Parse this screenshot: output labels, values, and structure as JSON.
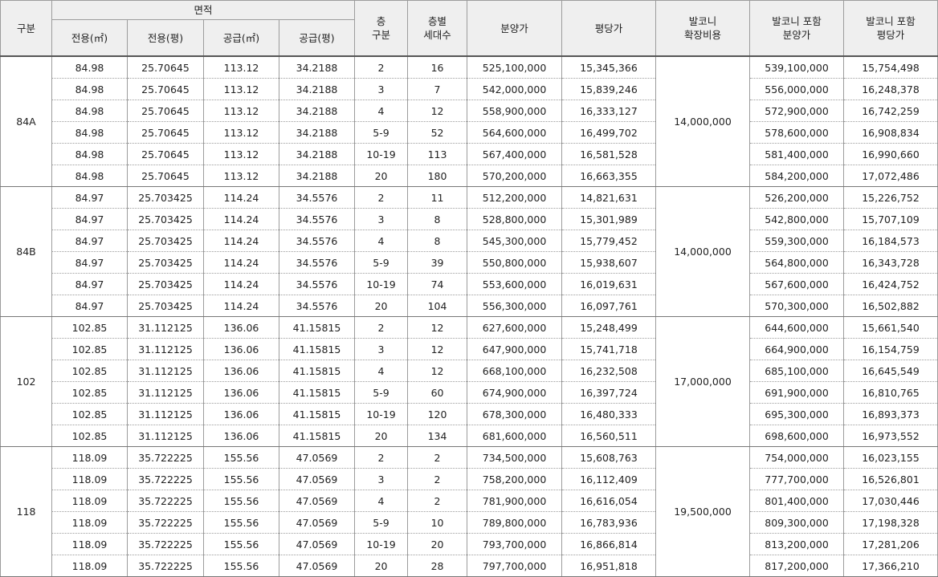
{
  "headers": {
    "type": "구분",
    "area_group": "면적",
    "area_sub": [
      "전용(㎡)",
      "전용(평)",
      "공급(㎡)",
      "공급(평)"
    ],
    "floor": [
      "층",
      "구분"
    ],
    "units": [
      "층별",
      "세대수"
    ],
    "price": "분양가",
    "per_pyeong": "평당가",
    "balcony_cost": [
      "발코니",
      "확장비용"
    ],
    "price_with_balcony": [
      "발코니 포함",
      "분양가"
    ],
    "per_pyeong_with_balcony": [
      "발코니 포함",
      "평당가"
    ]
  },
  "groups": [
    {
      "type": "84A",
      "balcony": "14,000,000",
      "rows": [
        [
          "84.98",
          "25.70645",
          "113.12",
          "34.2188",
          "2",
          "16",
          "525,100,000",
          "15,345,366",
          "539,100,000",
          "15,754,498"
        ],
        [
          "84.98",
          "25.70645",
          "113.12",
          "34.2188",
          "3",
          "7",
          "542,000,000",
          "15,839,246",
          "556,000,000",
          "16,248,378"
        ],
        [
          "84.98",
          "25.70645",
          "113.12",
          "34.2188",
          "4",
          "12",
          "558,900,000",
          "16,333,127",
          "572,900,000",
          "16,742,259"
        ],
        [
          "84.98",
          "25.70645",
          "113.12",
          "34.2188",
          "5-9",
          "52",
          "564,600,000",
          "16,499,702",
          "578,600,000",
          "16,908,834"
        ],
        [
          "84.98",
          "25.70645",
          "113.12",
          "34.2188",
          "10-19",
          "113",
          "567,400,000",
          "16,581,528",
          "581,400,000",
          "16,990,660"
        ],
        [
          "84.98",
          "25.70645",
          "113.12",
          "34.2188",
          "20",
          "180",
          "570,200,000",
          "16,663,355",
          "584,200,000",
          "17,072,486"
        ]
      ]
    },
    {
      "type": "84B",
      "balcony": "14,000,000",
      "rows": [
        [
          "84.97",
          "25.703425",
          "114.24",
          "34.5576",
          "2",
          "11",
          "512,200,000",
          "14,821,631",
          "526,200,000",
          "15,226,752"
        ],
        [
          "84.97",
          "25.703425",
          "114.24",
          "34.5576",
          "3",
          "8",
          "528,800,000",
          "15,301,989",
          "542,800,000",
          "15,707,109"
        ],
        [
          "84.97",
          "25.703425",
          "114.24",
          "34.5576",
          "4",
          "8",
          "545,300,000",
          "15,779,452",
          "559,300,000",
          "16,184,573"
        ],
        [
          "84.97",
          "25.703425",
          "114.24",
          "34.5576",
          "5-9",
          "39",
          "550,800,000",
          "15,938,607",
          "564,800,000",
          "16,343,728"
        ],
        [
          "84.97",
          "25.703425",
          "114.24",
          "34.5576",
          "10-19",
          "74",
          "553,600,000",
          "16,019,631",
          "567,600,000",
          "16,424,752"
        ],
        [
          "84.97",
          "25.703425",
          "114.24",
          "34.5576",
          "20",
          "104",
          "556,300,000",
          "16,097,761",
          "570,300,000",
          "16,502,882"
        ]
      ]
    },
    {
      "type": "102",
      "balcony": "17,000,000",
      "rows": [
        [
          "102.85",
          "31.112125",
          "136.06",
          "41.15815",
          "2",
          "12",
          "627,600,000",
          "15,248,499",
          "644,600,000",
          "15,661,540"
        ],
        [
          "102.85",
          "31.112125",
          "136.06",
          "41.15815",
          "3",
          "12",
          "647,900,000",
          "15,741,718",
          "664,900,000",
          "16,154,759"
        ],
        [
          "102.85",
          "31.112125",
          "136.06",
          "41.15815",
          "4",
          "12",
          "668,100,000",
          "16,232,508",
          "685,100,000",
          "16,645,549"
        ],
        [
          "102.85",
          "31.112125",
          "136.06",
          "41.15815",
          "5-9",
          "60",
          "674,900,000",
          "16,397,724",
          "691,900,000",
          "16,810,765"
        ],
        [
          "102.85",
          "31.112125",
          "136.06",
          "41.15815",
          "10-19",
          "120",
          "678,300,000",
          "16,480,333",
          "695,300,000",
          "16,893,373"
        ],
        [
          "102.85",
          "31.112125",
          "136.06",
          "41.15815",
          "20",
          "134",
          "681,600,000",
          "16,560,511",
          "698,600,000",
          "16,973,552"
        ]
      ]
    },
    {
      "type": "118",
      "balcony": "19,500,000",
      "rows": [
        [
          "118.09",
          "35.722225",
          "155.56",
          "47.0569",
          "2",
          "2",
          "734,500,000",
          "15,608,763",
          "754,000,000",
          "16,023,155"
        ],
        [
          "118.09",
          "35.722225",
          "155.56",
          "47.0569",
          "3",
          "2",
          "758,200,000",
          "16,112,409",
          "777,700,000",
          "16,526,801"
        ],
        [
          "118.09",
          "35.722225",
          "155.56",
          "47.0569",
          "4",
          "2",
          "781,900,000",
          "16,616,054",
          "801,400,000",
          "17,030,446"
        ],
        [
          "118.09",
          "35.722225",
          "155.56",
          "47.0569",
          "5-9",
          "10",
          "789,800,000",
          "16,783,936",
          "809,300,000",
          "17,198,328"
        ],
        [
          "118.09",
          "35.722225",
          "155.56",
          "47.0569",
          "10-19",
          "20",
          "793,700,000",
          "16,866,814",
          "813,200,000",
          "17,281,206"
        ],
        [
          "118.09",
          "35.722225",
          "155.56",
          "47.0569",
          "20",
          "28",
          "797,700,000",
          "16,951,818",
          "817,200,000",
          "17,366,210"
        ]
      ]
    }
  ]
}
